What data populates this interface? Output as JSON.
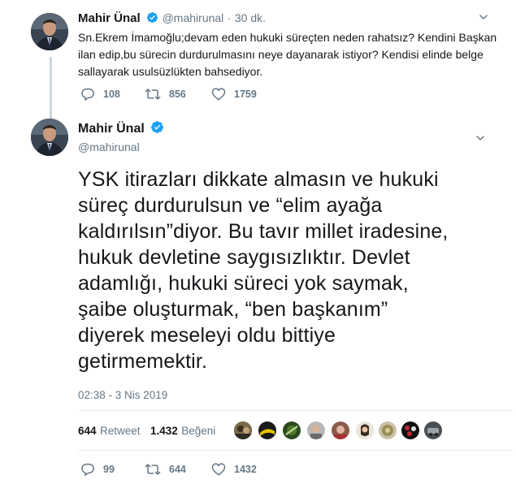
{
  "reply_tweet": {
    "author_name": "Mahir Ünal",
    "handle": "@mahirunal",
    "separator": "·",
    "time": "30 dk.",
    "text_lines": [
      "Sn.Ekrem İmamoğlu;devam eden hukuki süreçten neden rahatsız? Kendini Başkan",
      "ilan edip,bu sürecin durdurulmasını neye dayanarak istiyor? Kendisi elinde belge",
      "sallayarak usulsüzlükten bahsediyor."
    ],
    "replies": "108",
    "retweets": "856",
    "likes": "1759"
  },
  "main_tweet": {
    "author_name": "Mahir Ünal",
    "handle": "@mahirunal",
    "text_lines": [
      "YSK itirazları dikkate almasın ve hukuki",
      "süreç durdurulsun ve “elim ayağa",
      "kaldırılsın”diyor. Bu tavır millet iradesine,",
      "hukuk devletine saygısızlıktır. Devlet",
      "adamlığı, hukuki süreci yok saymak,",
      "şaibe oluşturmak, “ben başkanım”",
      "diyerek meseleyi oldu bittiye",
      "getirmemektir."
    ],
    "timestamp": "02:38 - 3 Nis 2019",
    "retweet_count": "644",
    "retweet_label": "Retweet",
    "like_count": "1.432",
    "like_label": "Beğeni",
    "replies": "99",
    "retweets": "644",
    "likes": "1432"
  },
  "colors": {
    "verified": "#1da1f2",
    "muted": "#657786",
    "text": "#14171a",
    "divider": "#e6ecf0",
    "thread_line": "#ccd6dd"
  },
  "icons": {
    "reply": "reply-icon",
    "retweet": "retweet-icon",
    "like": "heart-icon",
    "menu": "chevron-down-icon",
    "verified": "verified-badge-icon"
  }
}
